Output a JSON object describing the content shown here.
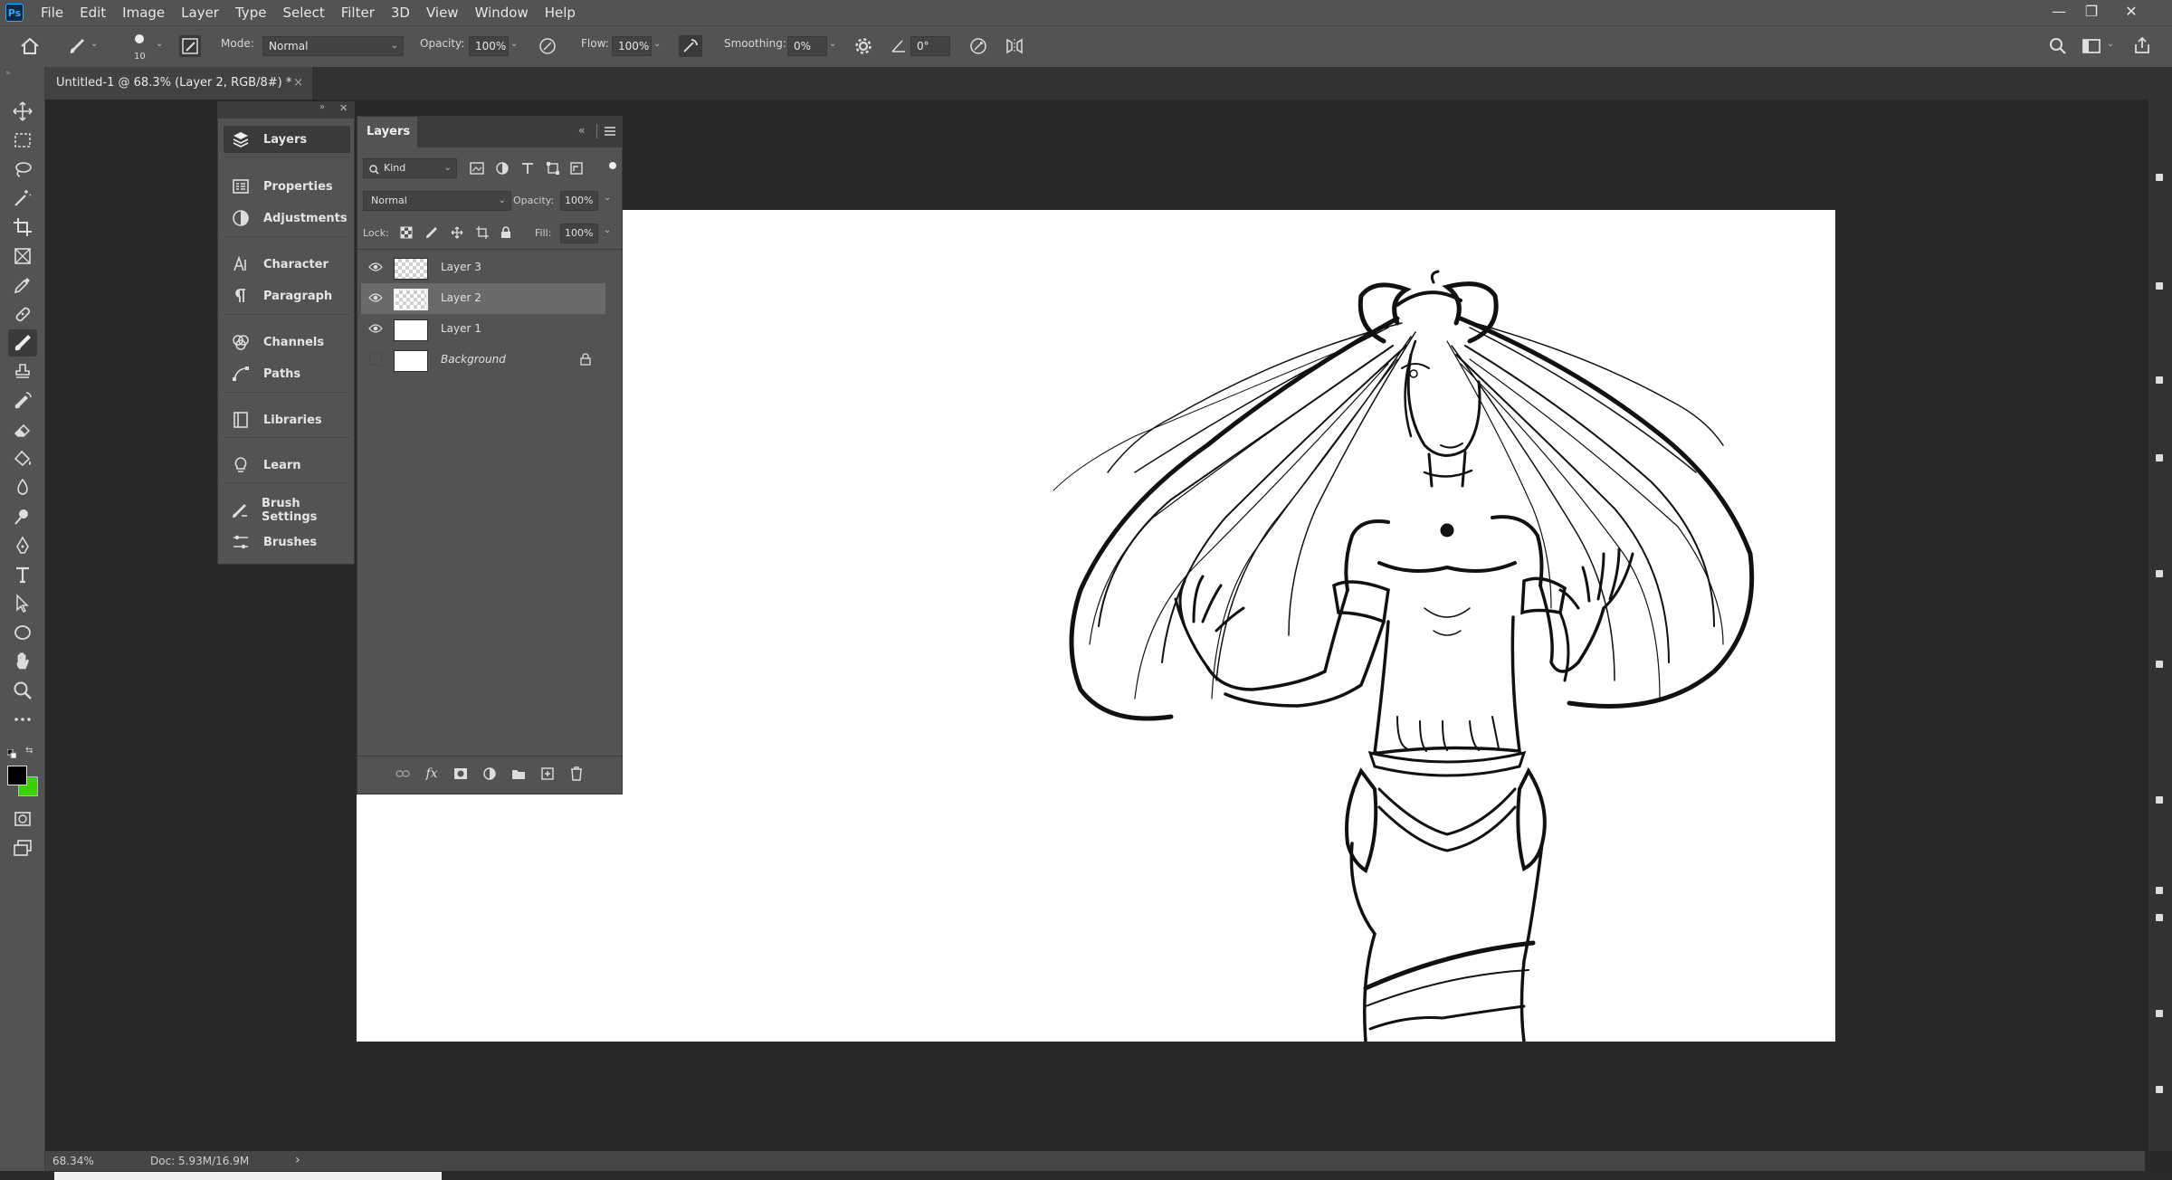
{
  "app": {
    "logo": "Ps",
    "menu": [
      "File",
      "Edit",
      "Image",
      "Layer",
      "Type",
      "Select",
      "Filter",
      "3D",
      "View",
      "Window",
      "Help"
    ]
  },
  "options_bar": {
    "brush_size": "10",
    "mode_label": "Mode:",
    "mode_value": "Normal",
    "opacity_label": "Opacity:",
    "opacity_value": "100%",
    "flow_label": "Flow:",
    "flow_value": "100%",
    "smoothing_label": "Smoothing:",
    "smoothing_value": "0%",
    "angle_value": "0°"
  },
  "document": {
    "tab_title": "Untitled-1 @ 68.3% (Layer 2, RGB/8#) *",
    "close": "×"
  },
  "panel_dock": {
    "items": [
      {
        "label": "Layers",
        "icon": "layers-icon"
      },
      {
        "label": "Properties",
        "icon": "properties-icon"
      },
      {
        "label": "Adjustments",
        "icon": "adjustments-icon"
      },
      {
        "label": "Character",
        "icon": "character-icon"
      },
      {
        "label": "Paragraph",
        "icon": "paragraph-icon"
      },
      {
        "label": "Channels",
        "icon": "channels-icon"
      },
      {
        "label": "Paths",
        "icon": "paths-icon"
      },
      {
        "label": "Libraries",
        "icon": "libraries-icon"
      },
      {
        "label": "Learn",
        "icon": "learn-icon"
      },
      {
        "label": "Brush Settings",
        "icon": "brush-settings-icon"
      },
      {
        "label": "Brushes",
        "icon": "brushes-icon"
      }
    ]
  },
  "layers_panel": {
    "title": "Layers",
    "filter_kind": "Kind",
    "blend_mode": "Normal",
    "opacity_label": "Opacity:",
    "opacity_value": "100%",
    "lock_label": "Lock:",
    "fill_label": "Fill:",
    "fill_value": "100%",
    "layers": [
      {
        "name": "Layer 3",
        "visible": true,
        "selected": false,
        "thumb": "transparent"
      },
      {
        "name": "Layer 2",
        "visible": true,
        "selected": true,
        "thumb": "transparent"
      },
      {
        "name": "Layer 1",
        "visible": true,
        "selected": false,
        "thumb": "white"
      },
      {
        "name": "Background",
        "visible": false,
        "selected": false,
        "thumb": "white",
        "locked": true
      }
    ]
  },
  "status_bar": {
    "zoom": "68.34%",
    "doc_size": "Doc: 5.93M/16.9M",
    "arrow": "›"
  },
  "colors": {
    "foreground": "#000000",
    "background": "#39d000",
    "selected_layer_bg": "#6a6a6a"
  }
}
